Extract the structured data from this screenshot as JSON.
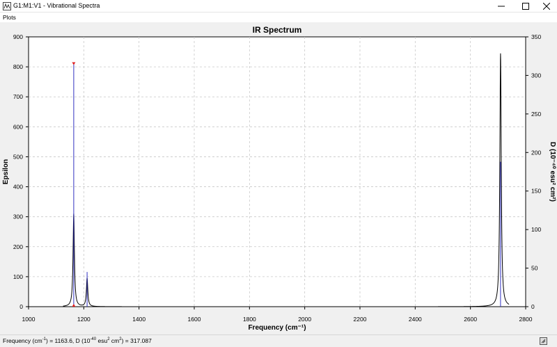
{
  "window": {
    "title": "G1:M1:V1 - Vibrational Spectra",
    "minimize_glyph": "—",
    "maximize_glyph": "☐",
    "close_glyph": "✕"
  },
  "menu": {
    "items": [
      "Plots"
    ]
  },
  "status": {
    "prefix": "Frequency (cm",
    "sup1": "-1",
    "mid1": ") = 1163.6, D (10",
    "sup2": "-40",
    "mid2": " esu",
    "sup3": "2",
    "mid3": " cm",
    "sup4": "2",
    "suffix": ") = 317.087"
  },
  "colors": {
    "spectrum_line": "#000000",
    "stick": "#3030c0",
    "marker": "#e02020",
    "grid": "#c8c8c8",
    "plot_bg": "#ffffff",
    "frame_bg": "#f0f0f0"
  },
  "chart_data": {
    "type": "line",
    "title": "IR Spectrum",
    "xlabel": "Frequency (cm⁻¹)",
    "ylabel_left": "Epsilon",
    "ylabel_right": "D (10⁻⁴⁰ esu² cm²)",
    "xlim": [
      1000,
      2800
    ],
    "ylim_left": [
      0,
      900
    ],
    "ylim_right": [
      0,
      350
    ],
    "x_ticks": [
      1000,
      1200,
      1400,
      1600,
      1800,
      2000,
      2200,
      2400,
      2600,
      2800
    ],
    "y_ticks_left": [
      0,
      100,
      200,
      300,
      400,
      500,
      600,
      700,
      800,
      900
    ],
    "y_ticks_right": [
      0,
      50,
      100,
      150,
      200,
      250,
      300,
      350
    ],
    "grid": true,
    "series": [
      {
        "kind": "spectrum",
        "axis": "left",
        "peaks": [
          {
            "x": 1163.6,
            "height": 310,
            "width": 6
          },
          {
            "x": 1212,
            "height": 95,
            "width": 6
          },
          {
            "x": 2709,
            "height": 845,
            "width": 6
          }
        ],
        "x_range": [
          1125,
          2740
        ]
      },
      {
        "kind": "sticks",
        "axis": "right",
        "x": [
          1163.6,
          1212,
          2709
        ],
        "values": [
          317.087,
          45,
          188
        ]
      }
    ],
    "selected_marker_x": 1163.6
  }
}
